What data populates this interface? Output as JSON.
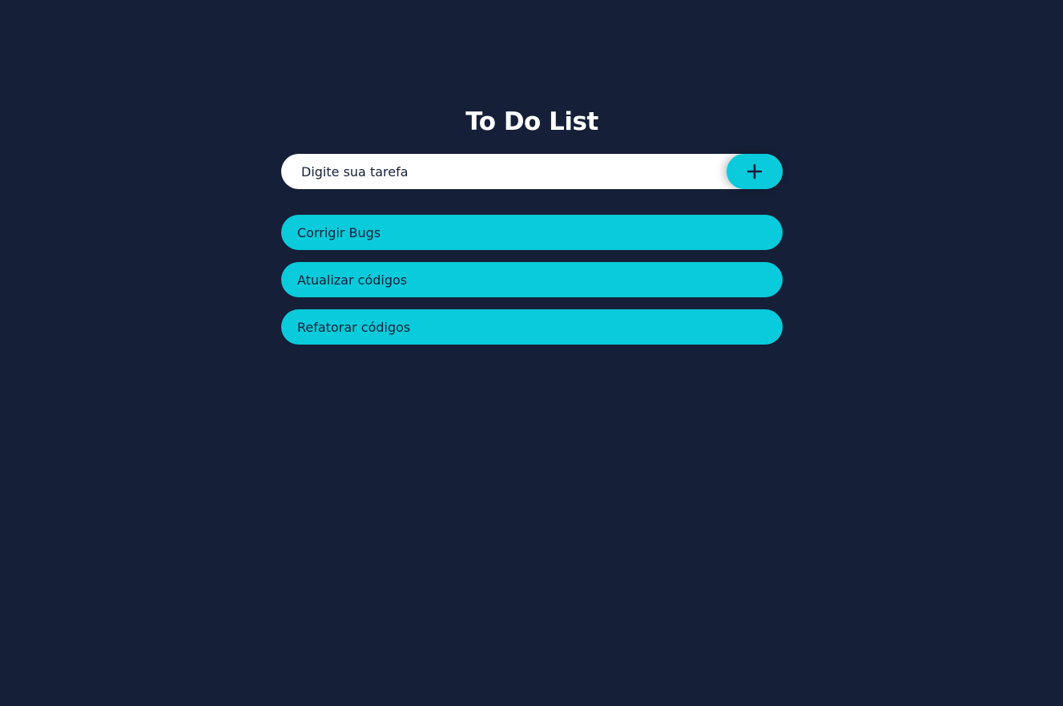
{
  "app": {
    "title": "To Do List"
  },
  "input": {
    "placeholder": "Digite sua tarefa",
    "value": ""
  },
  "add_button": {
    "icon": "plus-icon"
  },
  "tasks": [
    {
      "label": "Corrigir Bugs"
    },
    {
      "label": "Atualizar códigos"
    },
    {
      "label": "Refatorar códigos"
    }
  ],
  "colors": {
    "background": "#151f37",
    "accent": "#09cbdb",
    "input_background": "#ffffff",
    "text_dark": "#151f37",
    "title_text": "#ffffff"
  }
}
